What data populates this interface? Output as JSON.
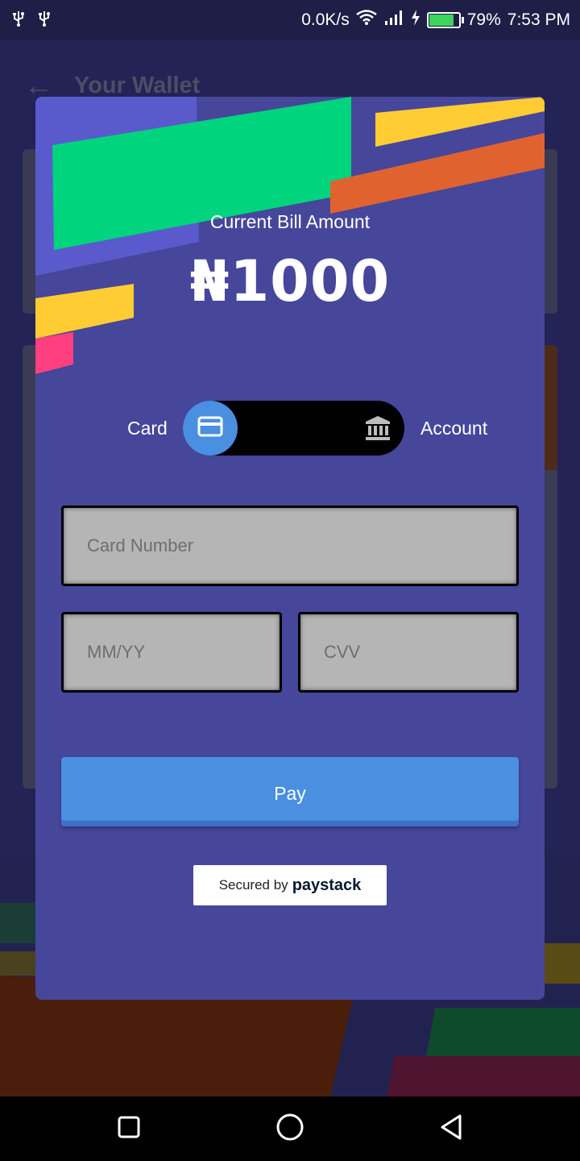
{
  "status_bar": {
    "left_icons": [
      "usb-icon",
      "usb-icon"
    ],
    "net_speed": "0.0K/s",
    "battery_percent": "79%",
    "battery_level": 0.79,
    "time": "7:53 PM"
  },
  "background_screen": {
    "title": "Your Wallet"
  },
  "payment_modal": {
    "bill_label": "Current Bill Amount",
    "bill_amount": "₦1000",
    "toggle": {
      "left_label": "Card",
      "right_label": "Account",
      "selected": "Card"
    },
    "fields": {
      "card_number_placeholder": "Card Number",
      "expiry_placeholder": "MM/YY",
      "cvv_placeholder": "CVV"
    },
    "pay_label": "Pay",
    "secured_by": "Secured by",
    "secured_brand": "paystack"
  },
  "colors": {
    "modal_bg": "#46469a",
    "pay_button": "#4a8fe0",
    "accent_green": "#00d47c",
    "accent_yellow": "#ffcc33",
    "accent_orange": "#e0632f",
    "accent_pink": "#ff3f7f"
  }
}
